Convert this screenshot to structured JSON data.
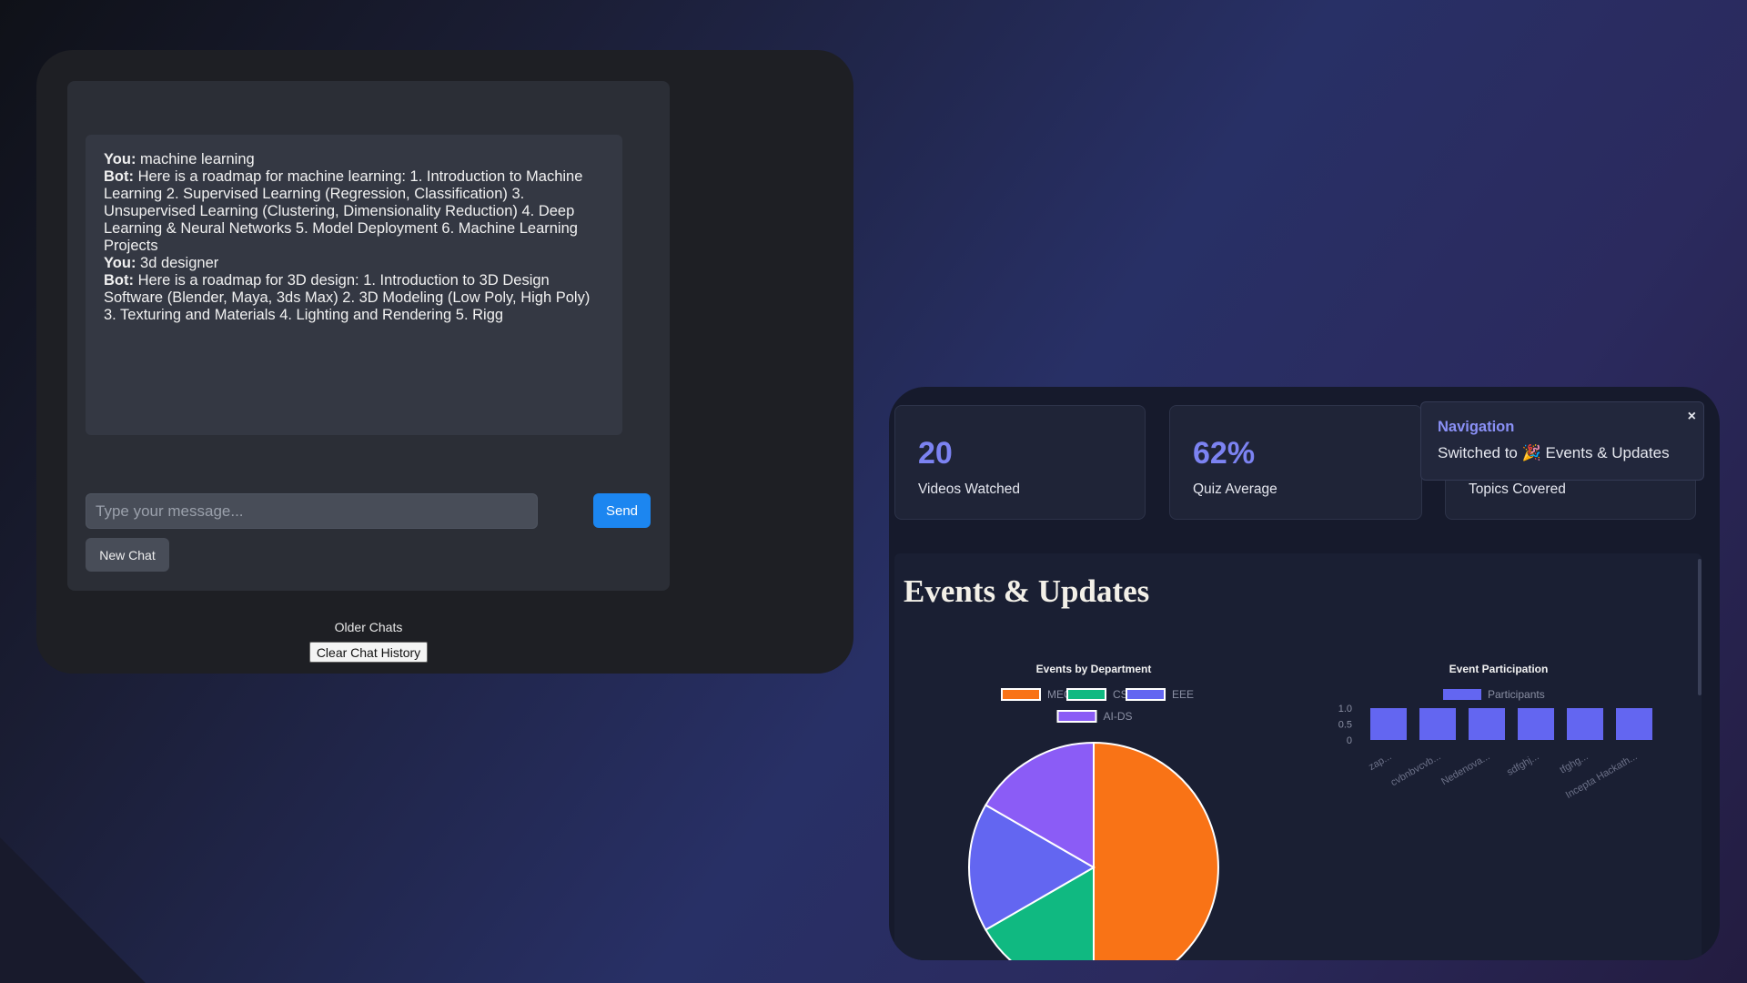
{
  "chat": {
    "messages": [
      {
        "speaker": "You:",
        "text": " machine learning"
      },
      {
        "speaker": "Bot:",
        "text": " Here is a roadmap for machine learning: 1. Introduction to Machine Learning 2. Supervised Learning (Regression, Classification) 3. Unsupervised Learning (Clustering, Dimensionality Reduction) 4. Deep Learning & Neural Networks 5. Model Deployment 6. Machine Learning Projects"
      },
      {
        "speaker": "You:",
        "text": " 3d designer"
      },
      {
        "speaker": "Bot:",
        "text": " Here is a roadmap for 3D design: 1. Introduction to 3D Design Software (Blender, Maya, 3ds Max) 2. 3D Modeling (Low Poly, High Poly) 3. Texturing and Materials 4. Lighting and Rendering 5. Rigg"
      }
    ],
    "input_placeholder": "Type your message...",
    "send_label": "Send",
    "new_chat_label": "New Chat",
    "older_chats_label": "Older Chats",
    "clear_history_label": "Clear Chat History"
  },
  "stats": {
    "videos": {
      "value": "20",
      "label": "Videos Watched"
    },
    "quiz": {
      "value": "62%",
      "label": "Quiz Average"
    },
    "topics": {
      "label": "Topics Covered"
    }
  },
  "toast": {
    "title": "Navigation",
    "message": "Switched to 🎉 Events & Updates",
    "close": "×"
  },
  "events": {
    "title": "Events & Updates"
  },
  "colors": {
    "accent": "#7c83f2",
    "send_button": "#1c86f0",
    "mech": "#f97316",
    "csc": "#10b981",
    "eee": "#6366f1",
    "aids": "#8b5cf6",
    "bar": "#6366f1"
  },
  "chart_data": [
    {
      "type": "pie",
      "title": "Events by Department",
      "categories": [
        "MECH",
        "CSC",
        "EEE",
        "AI-DS"
      ],
      "values": [
        3,
        1,
        1,
        1
      ],
      "colors": [
        "#f97316",
        "#10b981",
        "#6366f1",
        "#8b5cf6"
      ],
      "legend": "top"
    },
    {
      "type": "bar",
      "title": "Event Participation",
      "categories": [
        "zap...",
        "cvbnbvcvb...",
        "Nedenova...",
        "sdfghj...",
        "tfghg...",
        "Incepta Hackath..."
      ],
      "series": [
        {
          "name": "Participants",
          "values": [
            1,
            1,
            1,
            1,
            1,
            1
          ]
        }
      ],
      "yticks": [
        "1.0",
        "0.5",
        "0"
      ],
      "ylim": [
        0,
        1
      ],
      "legend": "top"
    }
  ]
}
